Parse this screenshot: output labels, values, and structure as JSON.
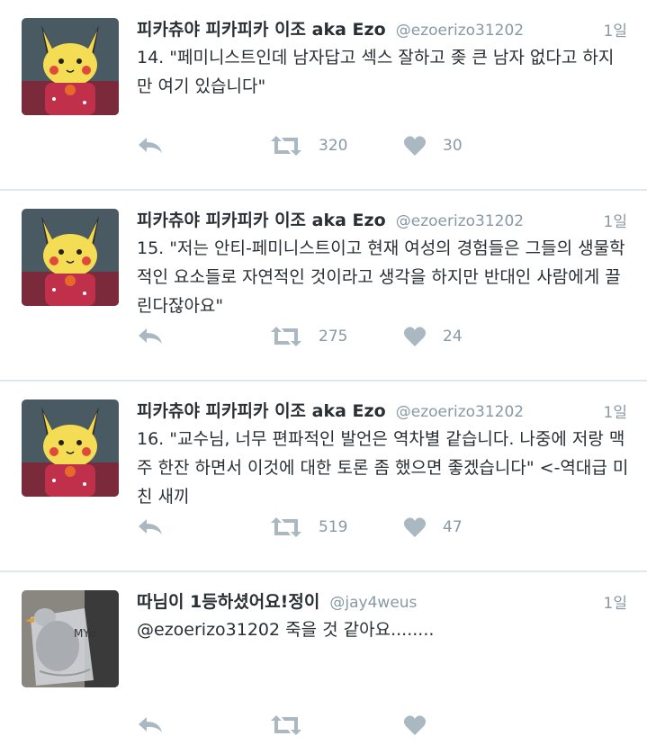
{
  "colors": {
    "text": "#292f33",
    "secondary": "#8899a6",
    "icon": "#aab8c2",
    "divider": "#e1e8ed"
  },
  "icons": {
    "reply": "reply-icon",
    "retweet": "retweet-icon",
    "like": "heart-icon"
  },
  "tweets": [
    {
      "name": "피카츄야 피카피카 이조 aka Ezo",
      "handle": "@ezoerizo31202",
      "time": "1일",
      "text": "14. \"페미니스트인데 남자답고 섹스 잘하고 좆 큰 남자 없다고 하지만 여기 있습니다\"",
      "retweets": "320",
      "likes": "30",
      "avatar": "pikachu-plush"
    },
    {
      "name": "피카츄야 피카피카 이조 aka Ezo",
      "handle": "@ezoerizo31202",
      "time": "1일",
      "text": "15. \"저는 안티-페미니스트이고 현재 여성의 경험들은 그들의 생물학적인 요소들로 자연적인 것이라고 생각을 하지만 반대인 사람에게 끌린다잖아요\"",
      "retweets": "275",
      "likes": "24",
      "avatar": "pikachu-plush"
    },
    {
      "name": "피카츄야 피카피카 이조 aka Ezo",
      "handle": "@ezoerizo31202",
      "time": "1일",
      "text": "16. \"교수님, 너무 편파적인 발언은 역차별 같습니다. 나중에 저랑 맥주 한잔 하면서 이것에 대한 토론 좀 했으면 좋겠습니다\" <-역대급 미친 새끼",
      "retweets": "519",
      "likes": "47",
      "avatar": "pikachu-plush"
    },
    {
      "name": "따님이 1등하셨어요!정이",
      "handle": "@jay4weus",
      "time": "1일",
      "text": "@ezoerizo31202 죽을 것 같아요........",
      "retweets": "",
      "likes": "",
      "avatar": "bird-figure-in-bag"
    }
  ]
}
